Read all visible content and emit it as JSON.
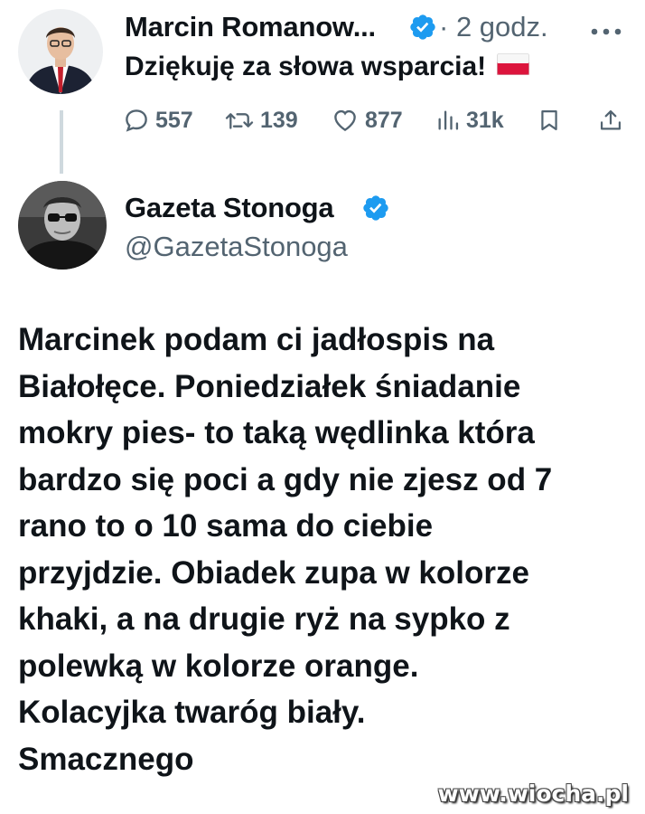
{
  "reply_tweet": {
    "author_name": "Marcin Romanow...",
    "time_separator": "·",
    "time": "2 godz.",
    "text": "Dziękuję za słowa wsparcia!",
    "flag": "poland-flag",
    "actions": {
      "replies": "557",
      "retweets": "139",
      "likes": "877",
      "views": "31k"
    }
  },
  "main_tweet": {
    "author_name": "Gazeta Stonoga",
    "handle": "@GazetaStonoga",
    "verified": true,
    "text_lines": [
      "Marcinek podam ci jadłospis na",
      "Białołęce. Poniedziałek śniadanie",
      "mokry pies- to taką wędlinka która",
      "bardzo się poci a gdy nie zjesz od 7",
      "rano to o 10 sama do ciebie",
      "przyjdzie. Obiadek zupa w kolorze",
      "khaki, a na drugie ryż na sypko z",
      "polewką w kolorze orange.",
      "Kolacyjka twaróg biały.",
      "Smacznego"
    ]
  },
  "watermark": "www.wiocha.pl",
  "colors": {
    "text": "#0f1419",
    "secondary": "#536471",
    "verified": "#1d9bf0",
    "thread_line": "#cfd9de"
  },
  "icons": [
    "reply-icon",
    "retweet-icon",
    "like-icon",
    "views-icon",
    "bookmark-icon",
    "share-icon",
    "more-icon",
    "verified-icon"
  ]
}
